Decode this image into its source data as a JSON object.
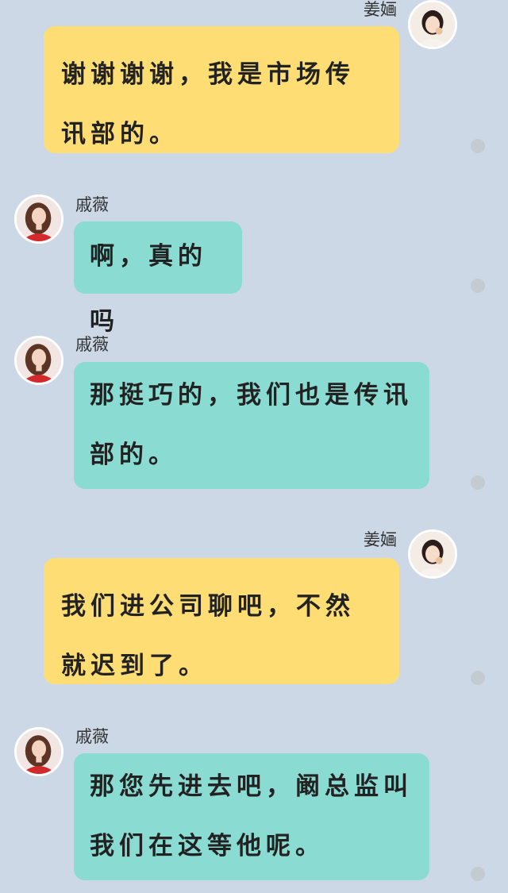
{
  "contacts": {
    "self": {
      "name": "姜婳",
      "avatar_icon": "woman-avatar-icon",
      "bubble_color": "#fedd75"
    },
    "other": {
      "name": "戚薇",
      "avatar_icon": "woman-avatar-icon",
      "bubble_color": "#8adbd1"
    }
  },
  "messages": [
    {
      "side": "right",
      "sender": "姜婳",
      "text": "谢谢谢谢，我是市场传讯部的。"
    },
    {
      "side": "left",
      "sender": "戚薇",
      "text": "啊，真的吗"
    },
    {
      "side": "left",
      "sender": "戚薇",
      "text": "那挺巧的，我们也是传讯部的。"
    },
    {
      "side": "right",
      "sender": "姜婳",
      "text": "我们进公司聊吧，不然就迟到了。"
    },
    {
      "side": "left",
      "sender": "戚薇",
      "text": "那您先进去吧，阚总监叫我们在这等他呢。"
    }
  ]
}
